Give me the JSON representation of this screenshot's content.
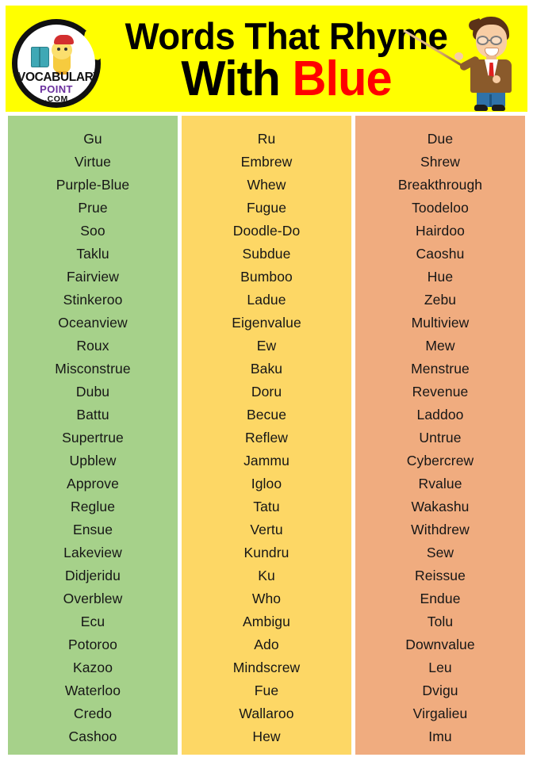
{
  "header": {
    "background_color": "#ffff00",
    "title_line1": "Words That Rhyme",
    "title_line2_prefix": "With ",
    "title_line2_highlight": "Blue",
    "highlight_color": "#ff0000",
    "logo": {
      "name": "vocabulary-point-logo",
      "line1": "VOCABULARY",
      "line2": "POINT",
      "line3": ".COM",
      "line2_color": "#6a2f9e"
    },
    "illustration": "teacher-with-pointer"
  },
  "columns": [
    {
      "name": "column-green",
      "color": "#a6d18a",
      "words": [
        "Gu",
        "Virtue",
        "Purple-Blue",
        "Prue",
        "Soo",
        "Taklu",
        "Fairview",
        "Stinkeroo",
        "Oceanview",
        "Roux",
        "Misconstrue",
        "Dubu",
        "Battu",
        "Supertrue",
        "Upblew",
        "Approve",
        "Reglue",
        "Ensue",
        "Lakeview",
        "Didjeridu",
        "Overblew",
        "Ecu",
        "Potoroo",
        "Kazoo",
        "Waterloo",
        "Credo",
        "Cashoo"
      ]
    },
    {
      "name": "column-yellow",
      "color": "#fdd765",
      "words": [
        "Ru",
        "Embrew",
        "Whew",
        "Fugue",
        "Doodle-Do",
        "Subdue",
        "Bumboo",
        "Ladue",
        "Eigenvalue",
        "Ew",
        "Baku",
        "Doru",
        "Becue",
        "Reflew",
        "Jammu",
        "Igloo",
        "Tatu",
        "Vertu",
        "Kundru",
        "Ku",
        "Who",
        "Ambigu",
        "Ado",
        "Mindscrew",
        "Fue",
        "Wallaroo",
        "Hew"
      ]
    },
    {
      "name": "column-orange",
      "color": "#f0ac7f",
      "words": [
        "Due",
        "Shrew",
        "Breakthrough",
        "Toodeloo",
        "Hairdoo",
        "Caoshu",
        "Hue",
        "Zebu",
        "Multiview",
        "Mew",
        "Menstrue",
        "Revenue",
        "Laddoo",
        "Untrue",
        "Cybercrew",
        "Rvalue",
        "Wakashu",
        "Withdrew",
        "Sew",
        "Reissue",
        "Endue",
        "Tolu",
        "Downvalue",
        "Leu",
        "Dvigu",
        "Virgalieu",
        "Imu"
      ]
    }
  ]
}
